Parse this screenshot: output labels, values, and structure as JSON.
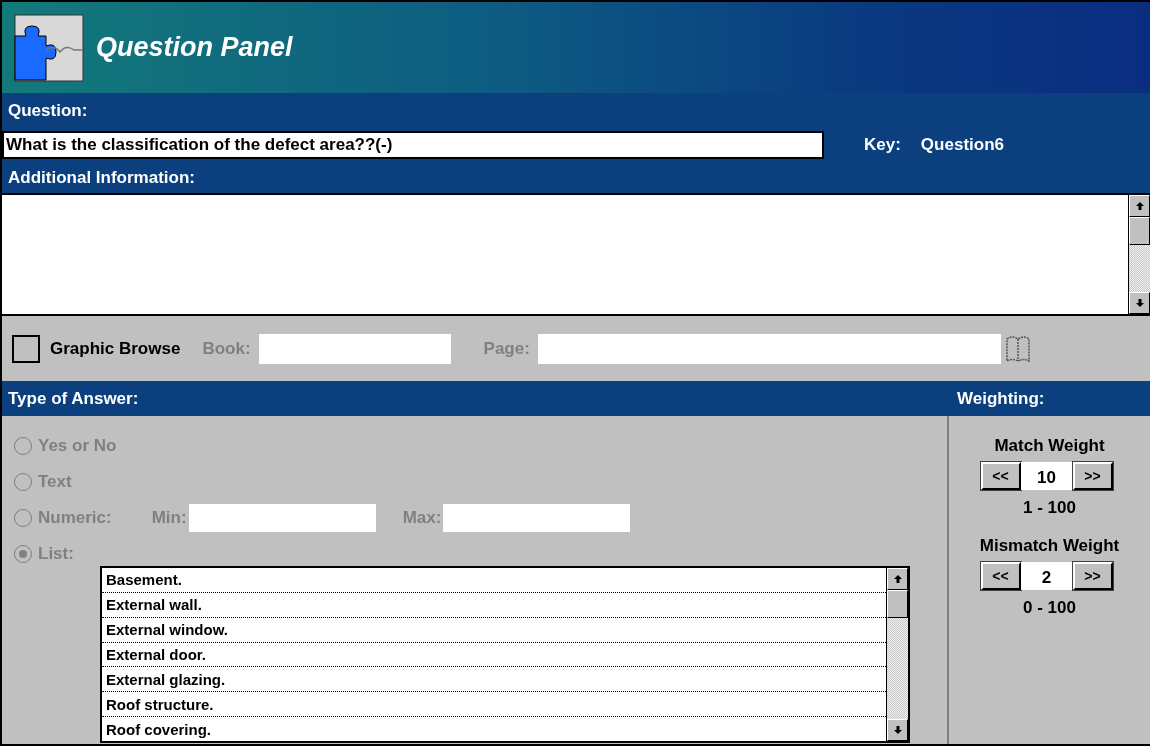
{
  "title": "Question Panel",
  "question": {
    "label": "Question:",
    "value": "What is the classification of the defect area??(-)"
  },
  "key": {
    "label": "Key:",
    "value": "Question6"
  },
  "additional_info": {
    "label": "Additional Information:"
  },
  "graphic_browse": {
    "label": "Graphic Browse",
    "checked": false,
    "book_label": "Book:",
    "page_label": "Page:"
  },
  "answer_type": {
    "label": "Type of Answer:",
    "disabled": true,
    "min_label": "Min:",
    "max_label": "Max:",
    "options": [
      {
        "label": "Yes or No",
        "selected": false,
        "kind": "plain"
      },
      {
        "label": "Text",
        "selected": false,
        "kind": "plain"
      },
      {
        "label": "Numeric:",
        "selected": false,
        "kind": "numeric"
      },
      {
        "label": "List:",
        "selected": true,
        "kind": "list"
      }
    ],
    "list_items": [
      "Basement.",
      "External wall.",
      "External window.",
      "External door.",
      "External glazing.",
      "Roof structure.",
      "Roof covering."
    ]
  },
  "weighting": {
    "label": "Weighting:",
    "weights": [
      {
        "label": "Match Weight",
        "decrease": "<<",
        "value": "10",
        "increase": ">>",
        "range": "1 - 100"
      },
      {
        "label": "Mismatch Weight",
        "decrease": "<<",
        "value": "2",
        "increase": ">>",
        "range": "0 - 100"
      }
    ]
  }
}
